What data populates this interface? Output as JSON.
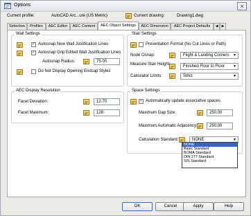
{
  "window": {
    "title": "Options",
    "close_glyph": "×"
  },
  "header": {
    "profile_label": "Current profile:",
    "profile_value": "AutoCAD Arc...ure (US Metric)",
    "drawing_label": "Current drawing:",
    "drawing_value": "Drawing1.dwg"
  },
  "tabs": [
    "Selection",
    "Profiles",
    "AEC Editor",
    "AEC Content",
    "AEC Object Settings",
    "AEC Dimension",
    "AEC Project Defaults"
  ],
  "wall": {
    "title": "Wall Settings",
    "opt1": "Autosnap New Wall Justification Lines",
    "opt2": "Autosnap Grip Edited Wall Justification Lines",
    "radius_label": "Autosnap Radius:",
    "radius_value": "75.00",
    "opt3": "Do Not Display Opening Endcap Styles"
  },
  "res": {
    "title": "AEC Display Resolution",
    "dev_label": "Facet Deviation:",
    "dev_value": "12.70",
    "max_label": "Facet Maximum:",
    "max_value": "128"
  },
  "stair": {
    "title": "Stair Settings",
    "opt1": "Presentation Format (No Cut Lines or Path)",
    "node_label": "Node Osnap:",
    "node_value": "Flight & Landing Corners",
    "height_label": "Measure Stair Height:",
    "height_value": "Finished Floor to Floor",
    "calc_label": "Calculator Limits:",
    "calc_value": "Strict"
  },
  "space": {
    "title": "Space Settings",
    "opt1": "Automatically update associative spaces",
    "gap_label": "Maximum Gap Size:",
    "gap_value": "250.00",
    "adj_label": "Maximum Automatic Adjacency:",
    "adj_value": "250.00",
    "calc_label": "Calculation Standard:",
    "calc_value": "NONE",
    "options": [
      "NONE",
      "Basic Standard",
      "BOMA Standard",
      "DIN 277 Standard",
      "SIS Standard"
    ]
  },
  "buttons": {
    "ok": "OK",
    "cancel": "Cancel",
    "apply": "Apply",
    "help": "Help"
  },
  "colors": {
    "selection": "#3364c7",
    "title_bg": "#e6eaf0"
  }
}
